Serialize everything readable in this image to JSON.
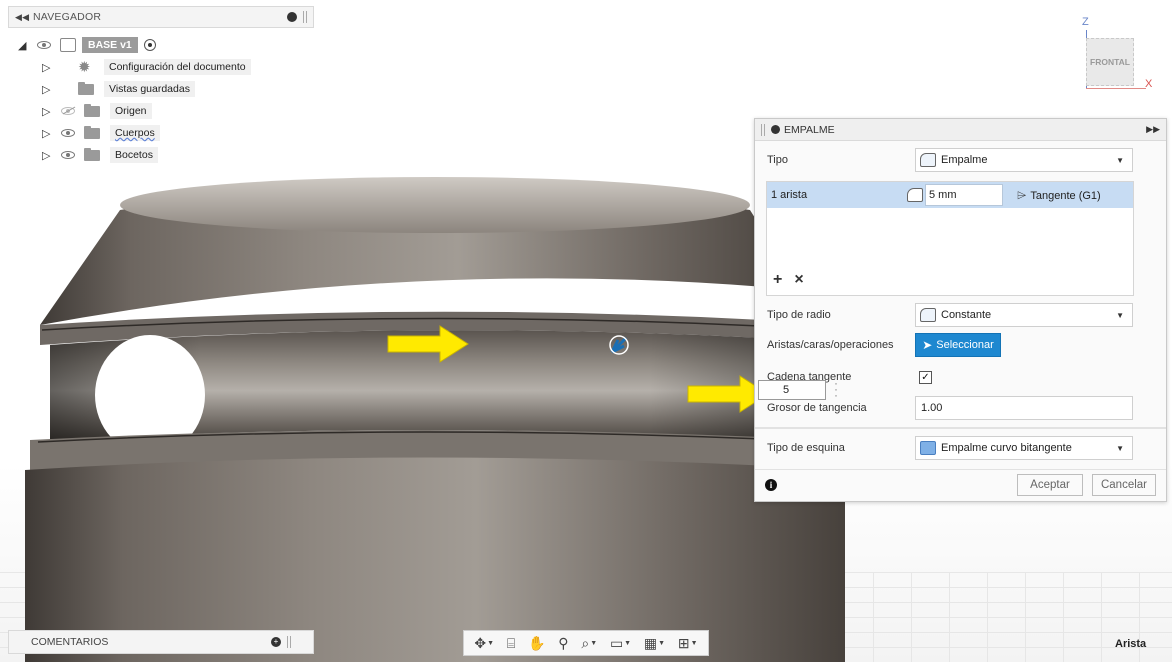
{
  "navigator": {
    "collapse_icon": "double-left-arrow-icon",
    "title": "NAVEGADOR",
    "root": {
      "label": "BASE v1"
    },
    "items": [
      {
        "label": "Configuración del documento",
        "icon": "gear-icon",
        "eye": "none"
      },
      {
        "label": "Vistas guardadas",
        "icon": "folder-icon",
        "eye": "none"
      },
      {
        "label": "Origen",
        "icon": "folder-icon",
        "eye": "hidden"
      },
      {
        "label": "Cuerpos",
        "icon": "folder-icon",
        "eye": "visible"
      },
      {
        "label": "Bocetos",
        "icon": "folder-icon",
        "eye": "visible"
      }
    ]
  },
  "viewcube": {
    "z_label": "Z",
    "x_label": "X",
    "face_label": "FRONTAL"
  },
  "fillet_panel": {
    "title": "EMPALME",
    "rows": {
      "type_label": "Tipo",
      "type_value": "Empalme",
      "selection_count": "1 arista",
      "radius_value": "5 mm",
      "continuity": "Tangente (G1)",
      "add_symbol": "+",
      "remove_symbol": "×",
      "radius_type_label": "Tipo de radio",
      "radius_type_value": "Constante",
      "edges_label": "Aristas/caras/operaciones",
      "select_button": "Seleccionar",
      "tangent_chain_label": "Cadena tangente",
      "tangent_chain_checked": "✓",
      "tangency_weight_label": "Grosor de tangencia",
      "tangency_weight_value": "1.00",
      "corner_type_label": "Tipo de esquina",
      "corner_type_value": "Empalme curvo bitangente"
    },
    "ok_button": "Aceptar",
    "cancel_button": "Cancelar",
    "info_symbol": "i"
  },
  "floating_input": {
    "value": "5"
  },
  "bottom": {
    "comments_label": "COMENTARIOS",
    "status": "Arista",
    "toolbar_icons": [
      "orbit-icon",
      "look-at-icon",
      "pan-icon",
      "zoom-icon",
      "fit-icon",
      "display-settings-icon",
      "grid-icon",
      "viewports-icon"
    ]
  },
  "colors": {
    "accent_blue": "#1e88d0",
    "selection_row": "#c7dcf3",
    "arrow_yellow": "#ffea00"
  }
}
